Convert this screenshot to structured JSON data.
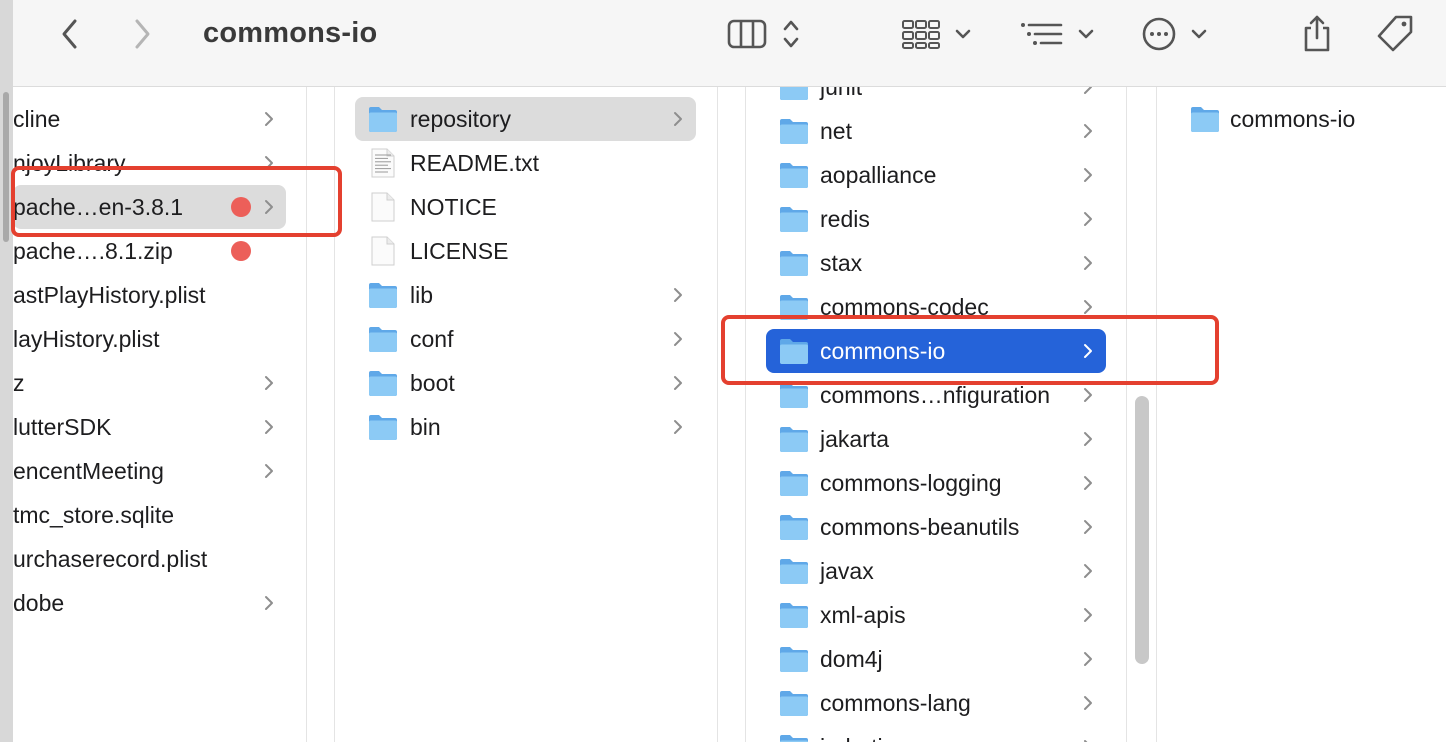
{
  "window": {
    "title": "commons-io"
  },
  "toolbar": {
    "back": "back",
    "forward": "forward",
    "view_columns": "columns-view",
    "group": "group",
    "sort": "sort",
    "more": "more",
    "share": "share",
    "tag": "tag"
  },
  "col1": {
    "items": [
      {
        "label": "cline",
        "has_chevron": true
      },
      {
        "label": "njoyLibrary",
        "has_chevron": true
      },
      {
        "label": "pache…en-3.8.1",
        "has_chevron": true,
        "tag": "red",
        "selected": true
      },
      {
        "label": "pache….8.1.zip",
        "has_chevron": false,
        "tag": "red"
      },
      {
        "label": "astPlayHistory.plist",
        "has_chevron": false
      },
      {
        "label": "layHistory.plist",
        "has_chevron": false
      },
      {
        "label": "z",
        "has_chevron": true
      },
      {
        "label": "lutterSDK",
        "has_chevron": true
      },
      {
        "label": "encentMeeting",
        "has_chevron": true
      },
      {
        "label": "tmc_store.sqlite",
        "has_chevron": false
      },
      {
        "label": "urchaserecord.plist",
        "has_chevron": false
      },
      {
        "label": "dobe",
        "has_chevron": true
      }
    ]
  },
  "col2": {
    "items": [
      {
        "label": "repository",
        "kind": "folder",
        "has_chevron": true,
        "selected": true
      },
      {
        "label": "README.txt",
        "kind": "text",
        "has_chevron": false
      },
      {
        "label": "NOTICE",
        "kind": "doc",
        "has_chevron": false
      },
      {
        "label": "LICENSE",
        "kind": "doc",
        "has_chevron": false
      },
      {
        "label": "lib",
        "kind": "folder",
        "has_chevron": true
      },
      {
        "label": "conf",
        "kind": "folder",
        "has_chevron": true
      },
      {
        "label": "boot",
        "kind": "folder",
        "has_chevron": true
      },
      {
        "label": "bin",
        "kind": "folder",
        "has_chevron": true
      }
    ]
  },
  "col3": {
    "items": [
      {
        "label": "junit"
      },
      {
        "label": "net"
      },
      {
        "label": "aopalliance"
      },
      {
        "label": "redis"
      },
      {
        "label": "stax"
      },
      {
        "label": "commons-codec"
      },
      {
        "label": "commons-io",
        "selected": true
      },
      {
        "label": "commons…nfiguration"
      },
      {
        "label": "jakarta"
      },
      {
        "label": "commons-logging"
      },
      {
        "label": "commons-beanutils"
      },
      {
        "label": "javax"
      },
      {
        "label": "xml-apis"
      },
      {
        "label": "dom4j"
      },
      {
        "label": "commons-lang"
      },
      {
        "label": "joda-time"
      }
    ]
  },
  "col4": {
    "items": [
      {
        "label": "commons-io"
      }
    ]
  },
  "colors": {
    "selection_blue": "#2563d9",
    "selection_gray": "#dcdcdc",
    "tag_red": "#ec5f59",
    "annotation_red": "#e4402f",
    "folder": "#7cbcf0"
  }
}
